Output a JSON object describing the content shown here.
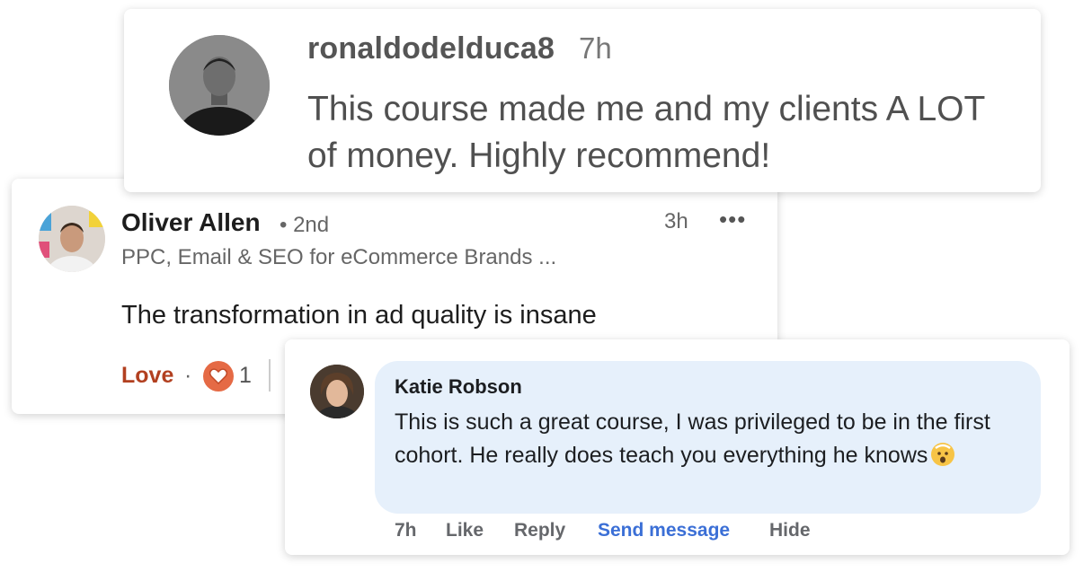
{
  "cards": [
    {
      "username": "ronaldodelduca8",
      "time": "7h",
      "text": "This course made me and my clients A LOT of money. Highly recommend!",
      "avatar_icon": "profile-photo"
    },
    {
      "name": "Oliver Allen",
      "degree": "• 2nd",
      "headline": "PPC, Email & SEO for eCommerce Brands ...",
      "time": "3h",
      "more": "•••",
      "comment": "The transformation in ad quality is insane",
      "reaction_label": "Love",
      "reaction_sep": "·",
      "reaction_icon": "heart-icon",
      "reaction_count": "1"
    },
    {
      "name": "Katie Robson",
      "text": "This is such a great course, I was privileged to be in the first cohort. He really does teach you everything he knows",
      "emoji": "mind-blown-emoji",
      "actions": {
        "time": "7h",
        "like": "Like",
        "reply": "Reply",
        "send_message": "Send message",
        "hide": "Hide"
      },
      "link_color": "#3b6fd6"
    }
  ],
  "colors": {
    "love": "#b24020",
    "heart_bg": "#e56a45",
    "bubble": "#e6f0fb"
  }
}
